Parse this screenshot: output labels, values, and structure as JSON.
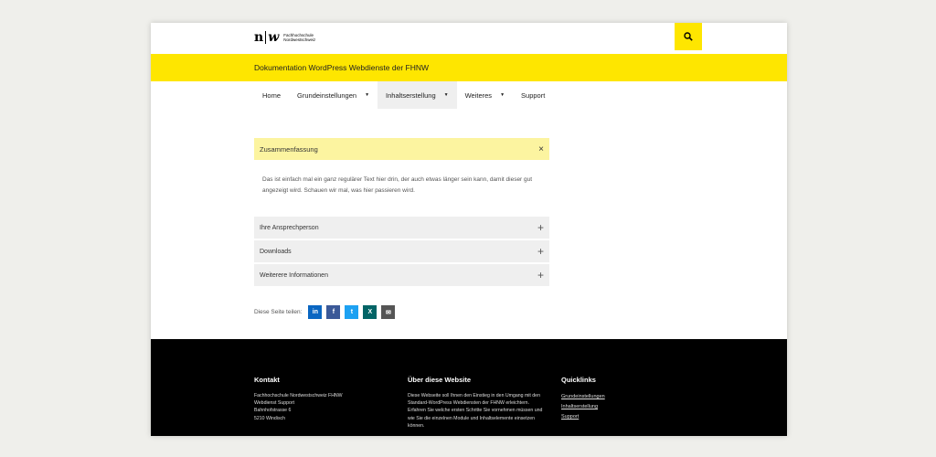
{
  "header": {
    "logo_mark_left": "n",
    "logo_mark_right": "w",
    "logo_line1": "Fachhochschule",
    "logo_line2": "Nordwestschweiz",
    "search_icon": "search-icon"
  },
  "site_title": "Dokumentation WordPress Webdienste der FHNW",
  "nav": {
    "items": [
      {
        "label": "Home",
        "has_dropdown": false
      },
      {
        "label": "Grundeinstellungen",
        "has_dropdown": true
      },
      {
        "label": "Inhaltserstellung",
        "has_dropdown": true,
        "active": true
      },
      {
        "label": "Weiteres",
        "has_dropdown": true
      },
      {
        "label": "Support",
        "has_dropdown": false
      }
    ],
    "arrow": "▼"
  },
  "summary": {
    "title": "Zusammenfassung",
    "close": "×"
  },
  "body_text": "Das ist einfach mal ein ganz regulärer Text hier drin, der auch etwas länger sein kann, damit dieser gut angezeigt wird. Schauen wir mal, was hier passieren wird.",
  "accordion": [
    {
      "label": "Ihre Ansprechperson",
      "icon": "+"
    },
    {
      "label": "Downloads",
      "icon": "+"
    },
    {
      "label": "Weiterere Informationen",
      "icon": "+"
    }
  ],
  "share": {
    "label": "Diese Seite teilen:",
    "buttons": [
      {
        "name": "linkedin-icon",
        "glyph": "in",
        "color": "#0a66c2"
      },
      {
        "name": "facebook-icon",
        "glyph": "f",
        "color": "#3b5998"
      },
      {
        "name": "twitter-icon",
        "glyph": "t",
        "color": "#1da1f2"
      },
      {
        "name": "xing-icon",
        "glyph": "X",
        "color": "#026466"
      },
      {
        "name": "email-icon",
        "glyph": "✉",
        "color": "#555555"
      }
    ]
  },
  "footer": {
    "contact": {
      "heading": "Kontakt",
      "lines": [
        "Fachhochschule Nordwestschweiz FHNW",
        "Webdienst Support",
        "Bahnhofstrasse 6",
        "5210 Windisch"
      ]
    },
    "about": {
      "heading": "Über diese Website",
      "text": "Diese Webseite soll Ihnen den Einstieg in den Umgang mit den Standard-WordPress Webdiensten der FHNW erleichtern. Erfahren Sie welche ersten Schritte Sie vornehmen müssen und wie Sie die einzelnen Module und Inhaltselemente einsetzen können."
    },
    "quicklinks": {
      "heading": "Quicklinks",
      "links": [
        "Grundeinstellungen",
        "Inhaltserstellung",
        "Support"
      ]
    }
  },
  "colors": {
    "brand_yellow": "#fee600",
    "summary_yellow": "#fcf4a0",
    "footer_bg": "#000000"
  }
}
